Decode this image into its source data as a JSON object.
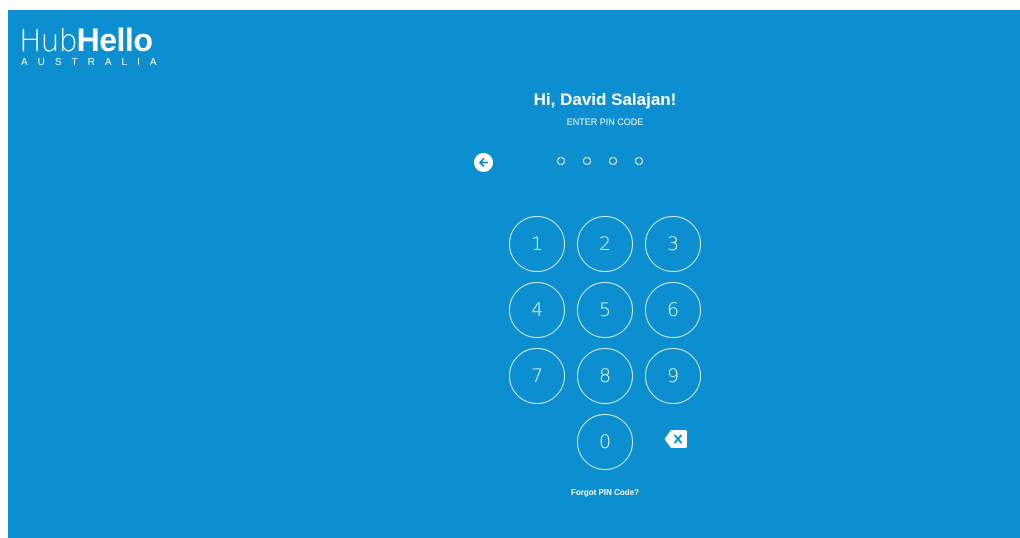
{
  "brand": {
    "name_light": "Hub",
    "name_bold": "Hello",
    "subtitle": "AUSTRALIA"
  },
  "greeting": "Hi, David Salajan!",
  "instruction": "ENTER PIN CODE",
  "pin": {
    "length": 4,
    "entered": 0
  },
  "keypad": {
    "keys": [
      "1",
      "2",
      "3",
      "4",
      "5",
      "6",
      "7",
      "8",
      "9",
      "0"
    ]
  },
  "forgot_link": "Forgot PIN Code?",
  "icons": {
    "back": "arrow-left-icon",
    "delete": "backspace-icon"
  },
  "colors": {
    "background": "#0b8fd0",
    "foreground": "#ffffff"
  }
}
